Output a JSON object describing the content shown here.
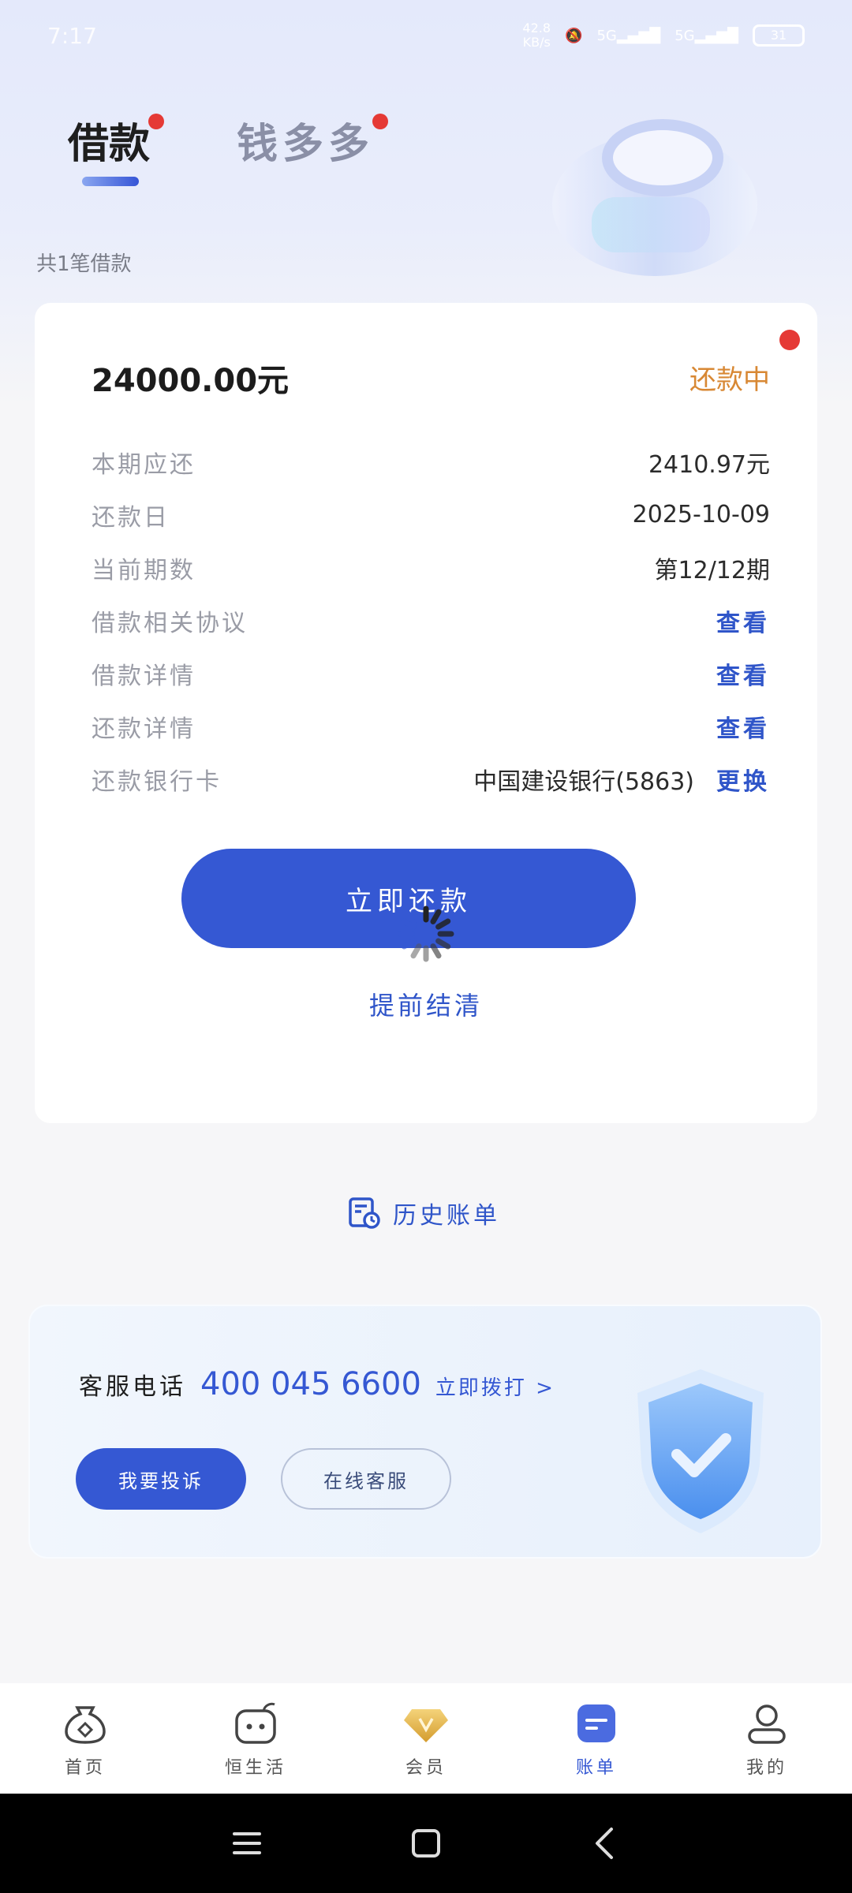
{
  "status_bar": {
    "time": "7:17",
    "net_speed_value": "42.8",
    "net_speed_unit": "KB/s",
    "signal_1": "5G",
    "signal_2": "5G",
    "battery": "31"
  },
  "tabs": [
    {
      "label": "借款",
      "active": true,
      "badge": true
    },
    {
      "label": "钱多多",
      "active": false,
      "badge": true
    }
  ],
  "loan_count": "共1笔借款",
  "loan": {
    "amount": "24000.00元",
    "status": "还款中",
    "rows": [
      {
        "label": "本期应还",
        "value": "2410.97元"
      },
      {
        "label": "还款日",
        "value": "2025-10-09"
      },
      {
        "label": "当前期数",
        "value": "第12/12期"
      },
      {
        "label": "借款相关协议",
        "link": "查看"
      },
      {
        "label": "借款详情",
        "link": "查看"
      },
      {
        "label": "还款详情",
        "link": "查看"
      },
      {
        "label": "还款银行卡",
        "value": "中国建设银行(5863)",
        "link": "更换"
      }
    ],
    "pay_button": "立即还款",
    "early_settle": "提前结清"
  },
  "history_label": "历史账单",
  "service": {
    "label": "客服电话",
    "phone": "400 045 6600",
    "call_label": "立即拨打 >",
    "complain_button": "我要投诉",
    "online_button": "在线客服"
  },
  "bottom_nav": [
    {
      "label": "首页",
      "icon": "home-bag-icon",
      "active": false
    },
    {
      "label": "恒生活",
      "icon": "life-robot-icon",
      "active": false
    },
    {
      "label": "会员",
      "icon": "vip-diamond-icon",
      "active": false
    },
    {
      "label": "账单",
      "icon": "bill-icon",
      "active": true
    },
    {
      "label": "我的",
      "icon": "profile-icon",
      "active": false
    }
  ],
  "colors": {
    "primary": "#3558d3",
    "status_orange": "#d88834",
    "badge_red": "#e53935"
  }
}
